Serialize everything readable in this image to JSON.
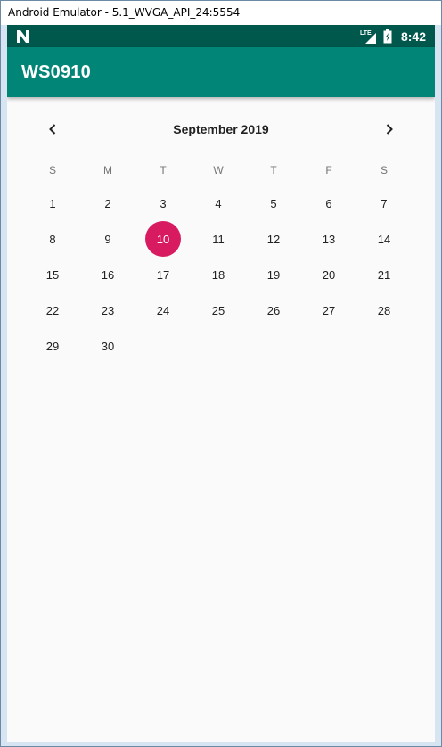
{
  "window": {
    "title": "Android Emulator - 5.1_WVGA_API_24:5554"
  },
  "status_bar": {
    "time": "8:42",
    "network": "LTE"
  },
  "app_bar": {
    "title": "WS0910"
  },
  "calendar": {
    "month_label": "September 2019",
    "weekdays": [
      "S",
      "M",
      "T",
      "W",
      "T",
      "F",
      "S"
    ],
    "leading_blanks": 0,
    "days": [
      "1",
      "2",
      "3",
      "4",
      "5",
      "6",
      "7",
      "8",
      "9",
      "10",
      "11",
      "12",
      "13",
      "14",
      "15",
      "16",
      "17",
      "18",
      "19",
      "20",
      "21",
      "22",
      "23",
      "24",
      "25",
      "26",
      "27",
      "28",
      "29",
      "30"
    ],
    "selected_day": "10",
    "selected_color": "#d81b60"
  },
  "colors": {
    "primary": "#008577",
    "primary_dark": "#00574b",
    "accent": "#d81b60"
  }
}
